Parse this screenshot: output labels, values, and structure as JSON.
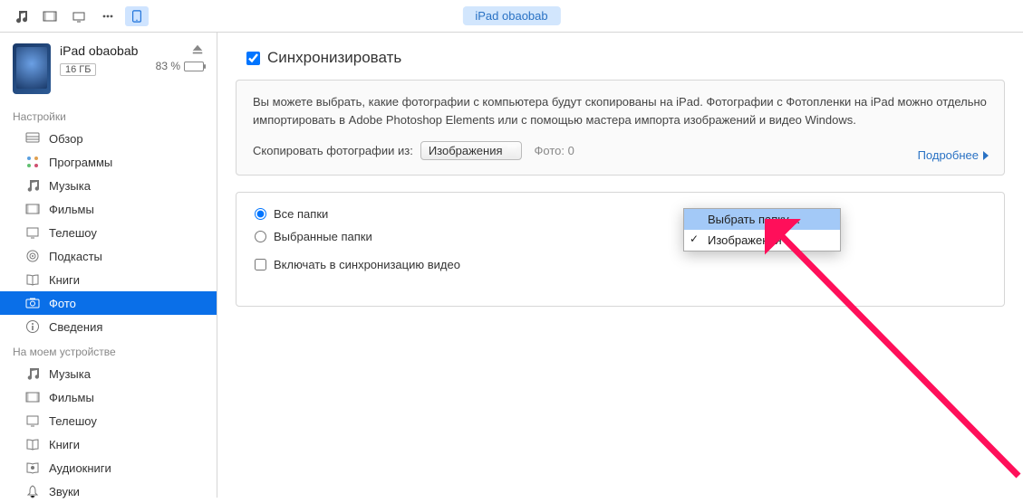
{
  "topbar": {
    "device_pill": "iPad obaobab"
  },
  "device": {
    "name": "iPad obaobab",
    "capacity": "16 ГБ",
    "battery_pct": "83 %"
  },
  "sidebar": {
    "section_settings": "Настройки",
    "section_on_device": "На моем устройстве",
    "settings": [
      {
        "icon": "overview",
        "label": "Обзор"
      },
      {
        "icon": "apps",
        "label": "Программы"
      },
      {
        "icon": "music",
        "label": "Музыка"
      },
      {
        "icon": "movies",
        "label": "Фильмы"
      },
      {
        "icon": "tvshows",
        "label": "Телешоу"
      },
      {
        "icon": "podcasts",
        "label": "Подкасты"
      },
      {
        "icon": "books",
        "label": "Книги"
      },
      {
        "icon": "photos",
        "label": "Фото"
      },
      {
        "icon": "info",
        "label": "Сведения"
      }
    ],
    "on_device": [
      {
        "icon": "music",
        "label": "Музыка"
      },
      {
        "icon": "movies",
        "label": "Фильмы"
      },
      {
        "icon": "tvshows",
        "label": "Телешоу"
      },
      {
        "icon": "books",
        "label": "Книги"
      },
      {
        "icon": "audiobooks",
        "label": "Аудиокниги"
      },
      {
        "icon": "tones",
        "label": "Звуки"
      }
    ]
  },
  "content": {
    "sync_label": "Синхронизировать",
    "info_text": "Вы можете выбрать, какие фотографии с компьютера будут скопированы на iPad. Фотографии с Фотопленки на iPad можно отдельно импортировать в Adobe Photoshop Elements или с помощью мастера импорта изображений и видео Windows.",
    "copy_label": "Скопировать фотографии из:",
    "dropdown_selected": "Изображения",
    "photo_count": "Фото: 0",
    "more_link": "Подробнее",
    "radio_all": "Все папки",
    "radio_selected": "Выбранные папки",
    "checkbox_video": "Включать в синхронизацию видео",
    "menu": {
      "choose_folder": "Выбрать папку…",
      "images": "Изображения"
    }
  }
}
